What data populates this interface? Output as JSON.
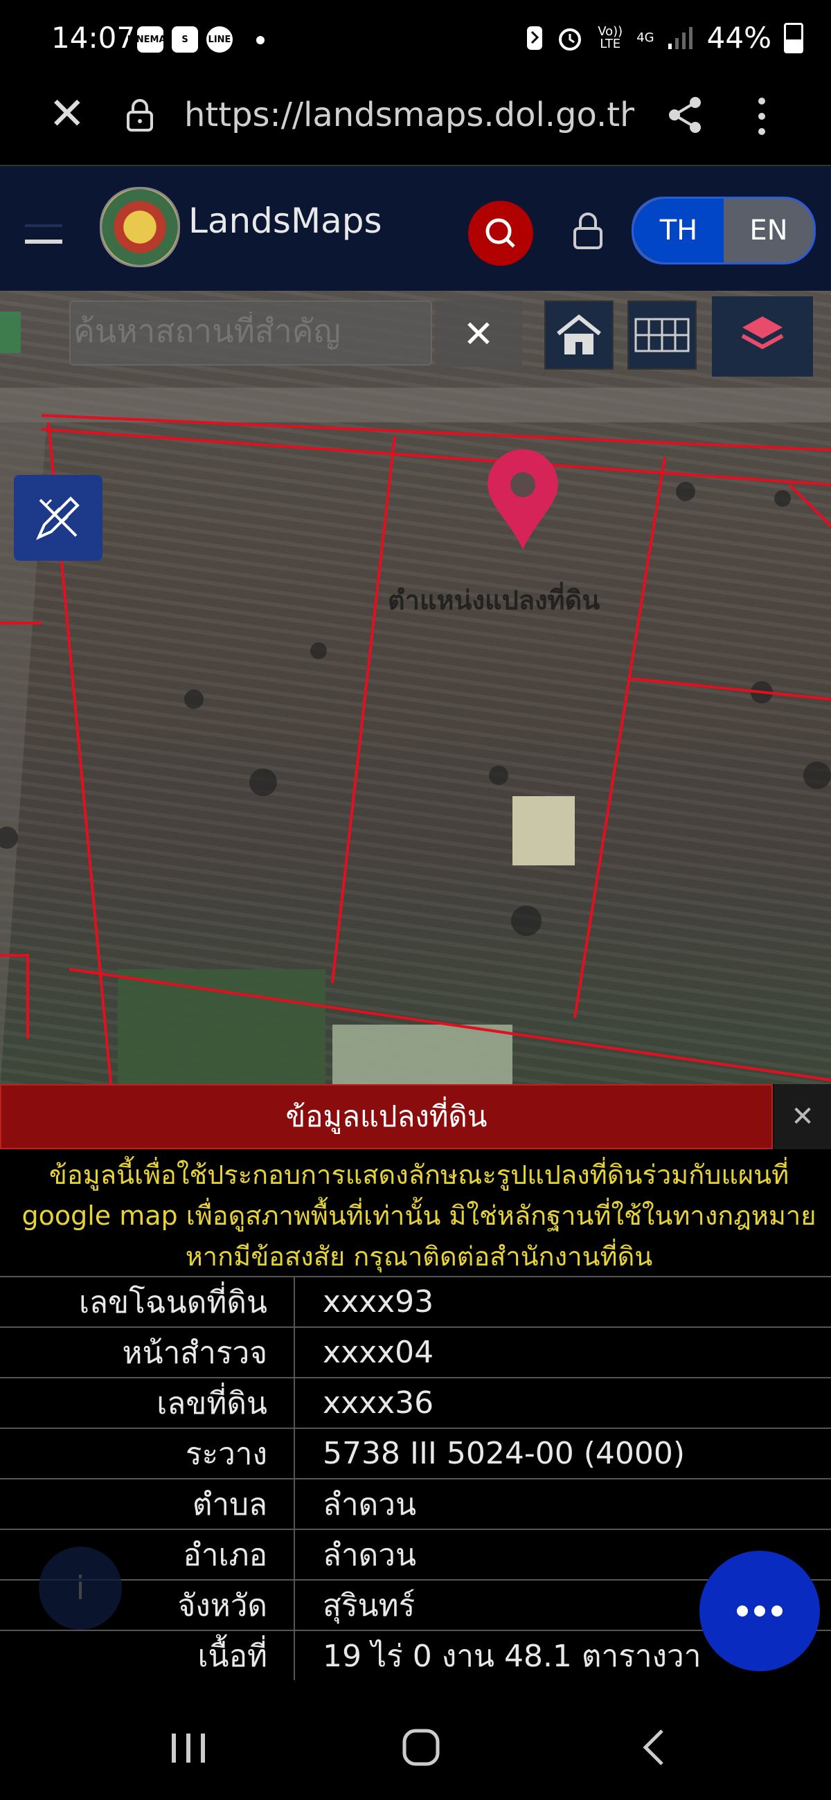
{
  "status_bar": {
    "time": "14:07",
    "apps": [
      "LINEMAN",
      "S",
      "LINE"
    ],
    "network_top": "Vo)) LTE",
    "network_4g": "4G",
    "battery": "44%",
    "battery_level": 0.44
  },
  "browser": {
    "url": "https://landsmaps.dol.go.th/#",
    "close_icon": "close-icon",
    "lock_icon": "lock-icon",
    "share_icon": "share-icon",
    "more_icon": "more-vertical-icon"
  },
  "header": {
    "title": "LandsMaps",
    "lang_th": "TH",
    "lang_en": "EN",
    "active_lang": "TH",
    "accent": "#0046c7",
    "search_color": "#b00000"
  },
  "map": {
    "search_placeholder": "ค้นหาสถานที่สำคัญ",
    "clear_label": "✕",
    "pin_label": "ตำแหน่งแปลงที่ดิน",
    "boundary_color": "#e01020",
    "pin_color": "#d62358"
  },
  "panel": {
    "title": "ข้อมูลแปลงที่ดิน",
    "close_label": "✕",
    "disclaimer": "ข้อมูลนี้เพื่อใช้ประกอบการแสดงลักษณะรูปแปลงที่ดินร่วมกับแผนที่ google map เพื่อดูสภาพพื้นที่เท่านั้น มิใช่หลักฐานที่ใช้ในทางกฎหมาย หากมีข้อสงสัย กรุณาติดต่อสำนักงานที่ดิน",
    "rows": [
      {
        "label": "เลขโฉนดที่ดิน",
        "value": "xxxx93"
      },
      {
        "label": "หน้าสำรวจ",
        "value": "xxxx04"
      },
      {
        "label": "เลขที่ดิน",
        "value": "xxxx36"
      },
      {
        "label": "ระวาง",
        "value": "5738 III 5024-00 (4000)"
      },
      {
        "label": "ตำบล",
        "value": "ลำดวน"
      },
      {
        "label": "อำเภอ",
        "value": "ลำดวน"
      },
      {
        "label": "จังหวัด",
        "value": "สุรินทร์"
      },
      {
        "label": "เนื้อที่",
        "value": "19 ไร่ 0 งาน 48.1 ตารางวา"
      }
    ],
    "info_label": "i",
    "fab_label": "•••"
  }
}
